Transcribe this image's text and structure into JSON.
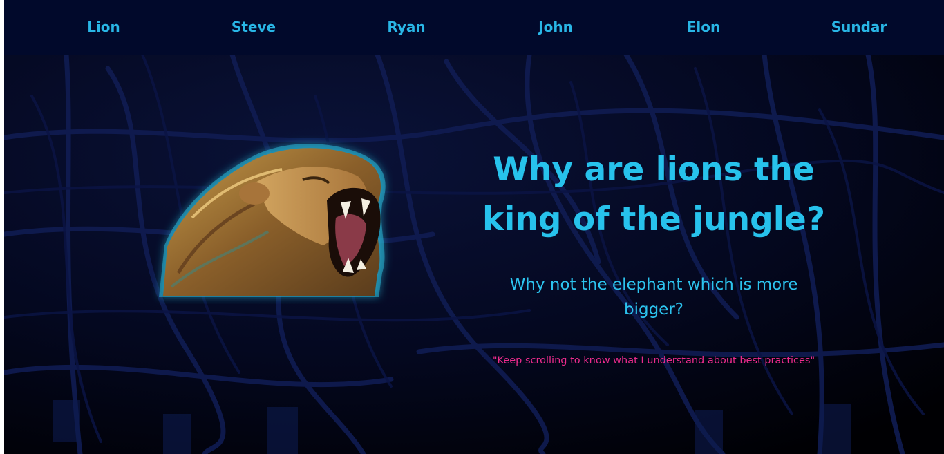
{
  "nav": {
    "items": [
      {
        "label": "Lion"
      },
      {
        "label": "Steve"
      },
      {
        "label": "Ryan"
      },
      {
        "label": "John"
      },
      {
        "label": "Elon"
      },
      {
        "label": "Sundar"
      }
    ]
  },
  "hero": {
    "image_icon": "roaring-lion-image",
    "title": "Why are lions the king of the jungle?",
    "subtitle": "Why not the elephant which is more bigger?",
    "quote": "\"Keep scrolling to know what I understand about best practices\""
  },
  "colors": {
    "nav_background": "#01092b",
    "nav_text": "#29b6e6",
    "title": "#27c2ec",
    "subtitle": "#2cc3ee",
    "quote": "#ec2b8c",
    "page_background": "#000000"
  }
}
